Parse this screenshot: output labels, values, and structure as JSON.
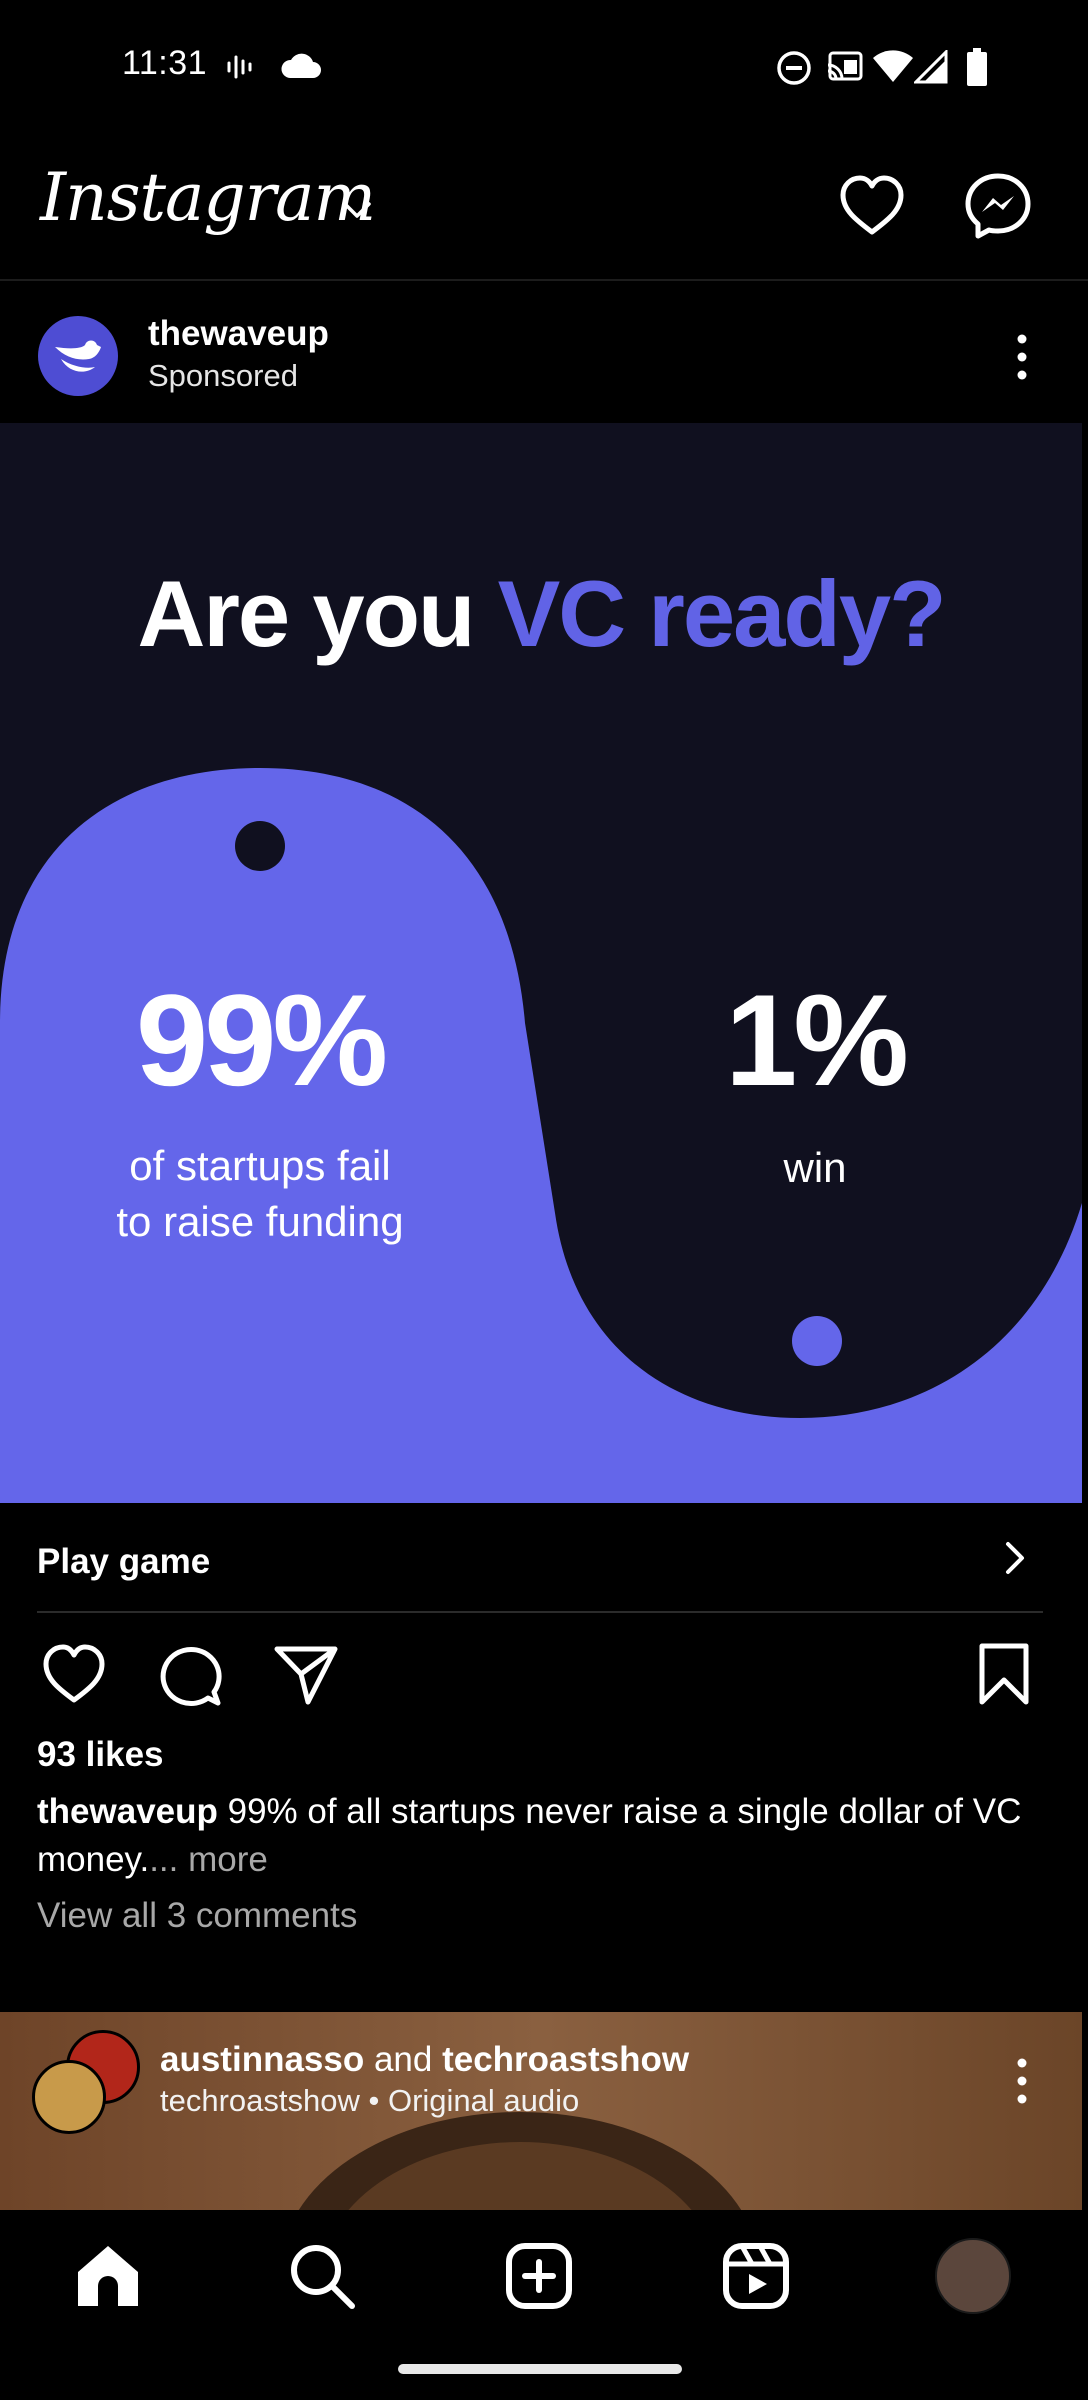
{
  "status_bar": {
    "time": "11:31"
  },
  "top_bar": {
    "logo_text": "Instagram"
  },
  "post": {
    "username": "thewaveup",
    "sponsored_label": "Sponsored",
    "ad": {
      "heading_plain": "Are you ",
      "heading_accent": "VC ready?",
      "stat_left_value": "99%",
      "stat_left_line1": "of startups fail",
      "stat_left_line2": "to raise funding",
      "stat_right_value": "1%",
      "stat_right_caption": "win"
    },
    "cta_label": "Play game",
    "likes": "93 likes",
    "caption_user": "thewaveup",
    "caption_text": " 99% of all startups never raise a single dollar of VC money.",
    "caption_more": "... more",
    "view_comments": "View all 3 comments"
  },
  "next_post": {
    "user1": "austinnasso",
    "and_text": " and ",
    "user2": "techroastshow",
    "audio": "techroastshow • Original audio"
  },
  "colors": {
    "accent": "#6163e6",
    "ad_background": "#10101f"
  }
}
